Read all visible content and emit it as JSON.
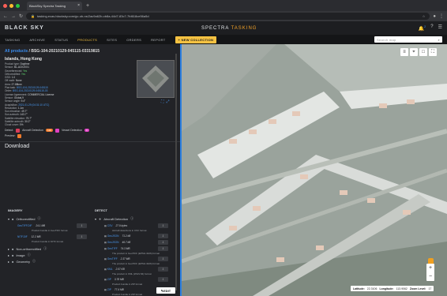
{
  "browser": {
    "tab_title": "BlackSky Spectra Tasking",
    "url": "tasking.ecas.blacksky.com/gv-ob-ns/2ac9a62b-cb8a-44d7-83c7-7fd618ce56a5d"
  },
  "app": {
    "logo": "BLACK SKY",
    "brand_main": "SPECTRA",
    "brand_accent": "TASKING",
    "notification_count": "2"
  },
  "nav": {
    "items": [
      "TASKING",
      "ARCHIVE",
      "STATUS",
      "PRODUCTS",
      "SITES",
      "ORDERS",
      "REPORT"
    ],
    "active": "PRODUCTS",
    "new_collection": "+ NEW COLLECTION",
    "search_placeholder": "Search map"
  },
  "panel": {
    "breadcrumb_back": "All products",
    "breadcrumb_id": "BSG-104-20210129-045115-03319815",
    "location": "Islands, Hong Kong",
    "meta": [
      {
        "k": "Product type:",
        "v": "Daytime"
      },
      {
        "k": "Sensor:",
        "v": "BL-ACK20X1"
      },
      {
        "k": "Georeferenced:",
        "v": "Yes"
      },
      {
        "k": "Orthorectified:",
        "v": "Yes"
      },
      {
        "k": "GSD:",
        "v": "1.0"
      },
      {
        "k": "Off nadir:",
        "v": "None"
      },
      {
        "k": "Area:",
        "v": "27.88km²"
      },
      {
        "k": "Plan task:",
        "v": "BSG-104-20210129-045115"
      },
      {
        "k": "Order:",
        "v": "BSG-104-20210129-045115-03"
      },
      {
        "k": "License Agreement:",
        "v": "COMMERCIAL License"
      },
      {
        "k": "Sensor:",
        "v": "Global-9"
      },
      {
        "k": "Sensor angle:",
        "v": "9.4°"
      },
      {
        "k": "Acquisition:",
        "v": "2021-01-29 (04:31:10 UTC)"
      },
      {
        "k": "Resolution:",
        "v": "1.1m"
      },
      {
        "k": "Sun elevation:",
        "v": "49.7°"
      },
      {
        "k": "Sun azimuth:",
        "v": "143.7°"
      },
      {
        "k": "Satellite elevation:",
        "v": "79.7°"
      },
      {
        "k": "Satellite azimuth:",
        "v": "30.2°"
      },
      {
        "k": "Cloud cover:",
        "v": "0%"
      }
    ],
    "detect_label": "Detect:",
    "aircraft_label": "Aircraft Detection",
    "aircraft_count": "120",
    "vessel_label": "Vessel Detection",
    "vessel_count": "0",
    "preview_label": "Preview:",
    "download_title": "Download",
    "imagery_header": "IMAGERY",
    "detect_header": "DETECT",
    "imagery": {
      "ortho_folder": "Orthorectified",
      "files": [
        {
          "name": "GeoTIFF.DIF",
          "size": "24.1 MB",
          "desc": "Product bundle in GeoTIFF format"
        },
        {
          "name": "NITF.DIF",
          "size": "12.2 MB",
          "desc": "Product bundle in NITF format"
        }
      ],
      "folders": [
        "Non-orthorectified",
        "Image",
        "Geometry"
      ]
    },
    "detect": {
      "folder": "Aircraft Detection",
      "files": [
        {
          "name": "CSV",
          "size": "27.9 bytes",
          "desc": "Aircraft detections in CSV format"
        },
        {
          "name": "GeoJSON",
          "size": "71.2 kB",
          "desc": ""
        },
        {
          "name": "GeoJSON",
          "size": "46.7 kB",
          "desc": ""
        },
        {
          "name": "GeoTIFF",
          "size": "74.3 MB",
          "desc": "The product in GeoTIFF (EPSG:4326) format"
        },
        {
          "name": "GeoTIFF",
          "size": "2.37 MB",
          "desc": "The product in GeoTIFF (EPSG:4326) format"
        },
        {
          "name": "KML",
          "size": "2.07 KB",
          "desc": "The product in KML (WGS 84) format"
        },
        {
          "name": "ZIP",
          "size": "3.78 MB",
          "desc": "Product bundle in ZIP format"
        },
        {
          "name": "ZIP",
          "size": "77.4 MB",
          "desc": "Product bundle in ZIP format"
        }
      ]
    },
    "edit_label": "EDIT"
  },
  "map": {
    "latitude_label": "Latitude:",
    "latitude": "22.3106",
    "longitude_label": "Longitude:",
    "longitude": "113.9062",
    "zoom_label": "Zoom Level:",
    "zoom": "17"
  },
  "colors": {
    "accent_yellow": "#f5c242",
    "link_blue": "#4a9af3",
    "divider_blue": "#2c7fe0",
    "orange_badge": "#f07b2c",
    "magenta_badge": "#e040c4"
  }
}
